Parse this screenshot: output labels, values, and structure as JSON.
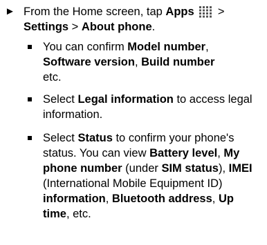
{
  "step": {
    "arrow": "►",
    "parts": [
      "From the Home screen, tap ",
      "Apps",
      " > ",
      "Settings",
      " > ",
      "About phone",
      "."
    ]
  },
  "icons": {
    "apps": "apps-grid-icon"
  },
  "sub_items": [
    {
      "parts": [
        "You can confirm ",
        "Model number",
        ", ",
        "Software version",
        ", ",
        "Build number",
        " etc."
      ]
    },
    {
      "parts": [
        "Select ",
        "Legal information",
        " to access legal information."
      ]
    },
    {
      "parts": [
        "Select ",
        "Status",
        " to confirm your phone's status. You can view ",
        "Battery level",
        ", ",
        "My phone number",
        " (under ",
        "SIM status",
        "), ",
        "IMEI",
        " (International Mobile Equipment ID) ",
        "information",
        ", ",
        "Bluetooth address",
        ", ",
        "Up time",
        ", etc."
      ]
    }
  ]
}
